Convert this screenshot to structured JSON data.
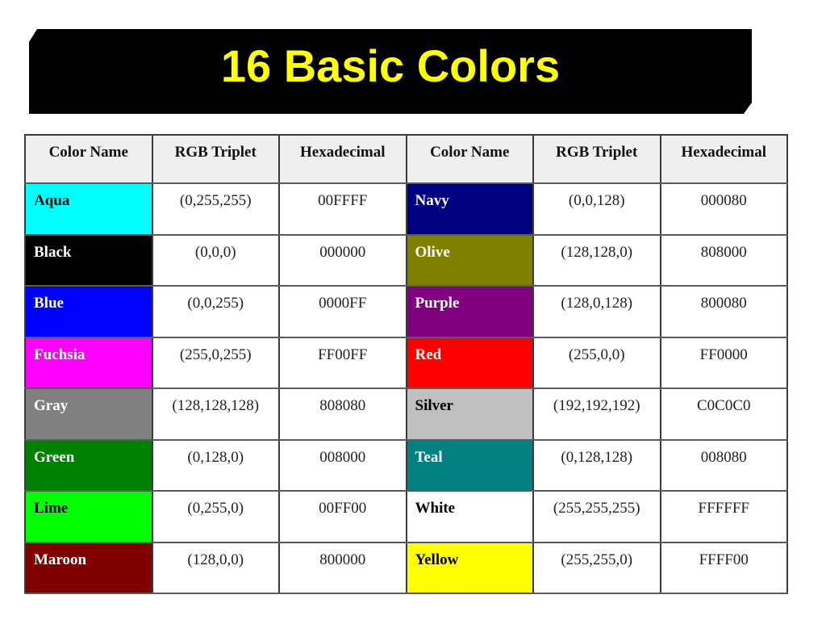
{
  "title": "16 Basic Colors",
  "headers": [
    "Color Name",
    "RGB Triplet",
    "Hexadecimal",
    "Color Name",
    "RGB Triplet",
    "Hexadecimal"
  ],
  "rows": [
    {
      "left": {
        "name": "Aqua",
        "rgb": "(0,255,255)",
        "hex": "00FFFF",
        "swatch": "#00FFFF",
        "text": "#000000"
      },
      "right": {
        "name": "Navy",
        "rgb": "(0,0,128)",
        "hex": "000080",
        "swatch": "#000080",
        "text": "#FFFFFF"
      }
    },
    {
      "left": {
        "name": "Black",
        "rgb": "(0,0,0)",
        "hex": "000000",
        "swatch": "#000000",
        "text": "#FFFFFF"
      },
      "right": {
        "name": "Olive",
        "rgb": "(128,128,0)",
        "hex": "808000",
        "swatch": "#808000",
        "text": "#FFFFFF"
      }
    },
    {
      "left": {
        "name": "Blue",
        "rgb": "(0,0,255)",
        "hex": "0000FF",
        "swatch": "#0000FF",
        "text": "#FFFFFF"
      },
      "right": {
        "name": "Purple",
        "rgb": "(128,0,128)",
        "hex": "800080",
        "swatch": "#800080",
        "text": "#FFFFFF"
      }
    },
    {
      "left": {
        "name": "Fuchsia",
        "rgb": "(255,0,255)",
        "hex": "FF00FF",
        "swatch": "#FF00FF",
        "text": "#FFFFFF"
      },
      "right": {
        "name": "Red",
        "rgb": "(255,0,0)",
        "hex": "FF0000",
        "swatch": "#FF0000",
        "text": "#FFFFFF"
      }
    },
    {
      "left": {
        "name": "Gray",
        "rgb": "(128,128,128)",
        "hex": "808080",
        "swatch": "#808080",
        "text": "#FFFFFF"
      },
      "right": {
        "name": "Silver",
        "rgb": "(192,192,192)",
        "hex": "C0C0C0",
        "swatch": "#C0C0C0",
        "text": "#000000"
      }
    },
    {
      "left": {
        "name": "Green",
        "rgb": "(0,128,0)",
        "hex": "008000",
        "swatch": "#008000",
        "text": "#FFFFFF"
      },
      "right": {
        "name": "Teal",
        "rgb": "(0,128,128)",
        "hex": "008080",
        "swatch": "#008080",
        "text": "#FFFFFF"
      }
    },
    {
      "left": {
        "name": "Lime",
        "rgb": "(0,255,0)",
        "hex": "00FF00",
        "swatch": "#00FF00",
        "text": "#000000"
      },
      "right": {
        "name": "White",
        "rgb": "(255,255,255)",
        "hex": "FFFFFF",
        "swatch": "#FFFFFF",
        "text": "#000000"
      }
    },
    {
      "left": {
        "name": "Maroon",
        "rgb": "(128,0,0)",
        "hex": "800000",
        "swatch": "#800000",
        "text": "#FFFFFF"
      },
      "right": {
        "name": "Yellow",
        "rgb": "(255,255,0)",
        "hex": "FFFF00",
        "swatch": "#FFFF00",
        "text": "#000000"
      }
    }
  ]
}
